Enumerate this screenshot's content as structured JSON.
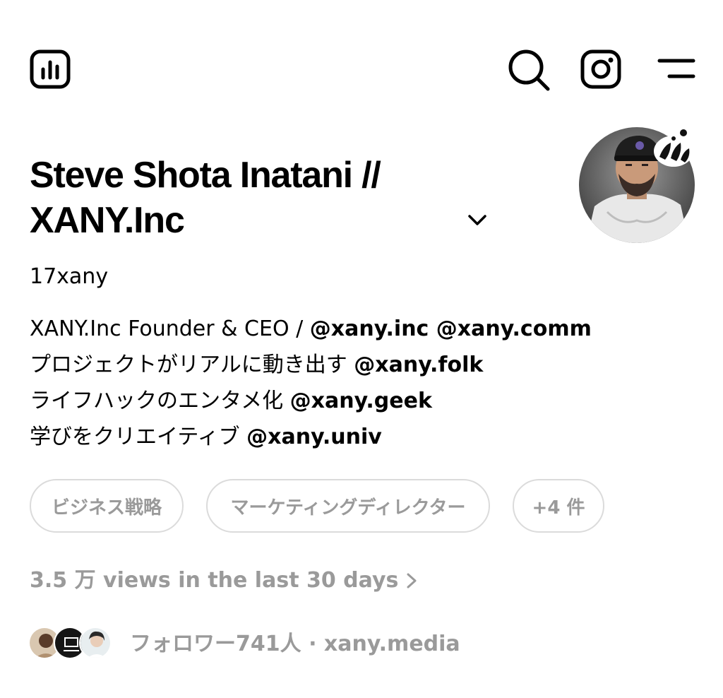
{
  "profile": {
    "name": "Steve Shota Inatani // XANY.Inc",
    "username": "17xany",
    "bio_lines": [
      {
        "text": "XANY.Inc Founder & CEO / ",
        "mention": "@xany.inc @xany.comm"
      },
      {
        "text": "プロジェクトがリアルに動き出す ",
        "mention": "@xany.folk"
      },
      {
        "text": "ライフハックのエンタメ化 ",
        "mention": "@xany.geek"
      },
      {
        "text": "学びをクリエイティブ ",
        "mention": "@xany.univ"
      }
    ],
    "tags": [
      "ビジネス戦略",
      "マーケティングディレクター",
      "+4 件"
    ],
    "views_text": "3.5 万 views in the last 30 days",
    "followers_text": "フォロワー741人 · xany.media"
  },
  "icons": {
    "insights": "insights-icon",
    "search": "search-icon",
    "instagram": "instagram-icon",
    "menu": "menu-icon",
    "chevron": "chevron-down-icon"
  },
  "colors": {
    "text": "#000000",
    "muted": "#9a9a9a",
    "border": "#dbdbdb"
  }
}
